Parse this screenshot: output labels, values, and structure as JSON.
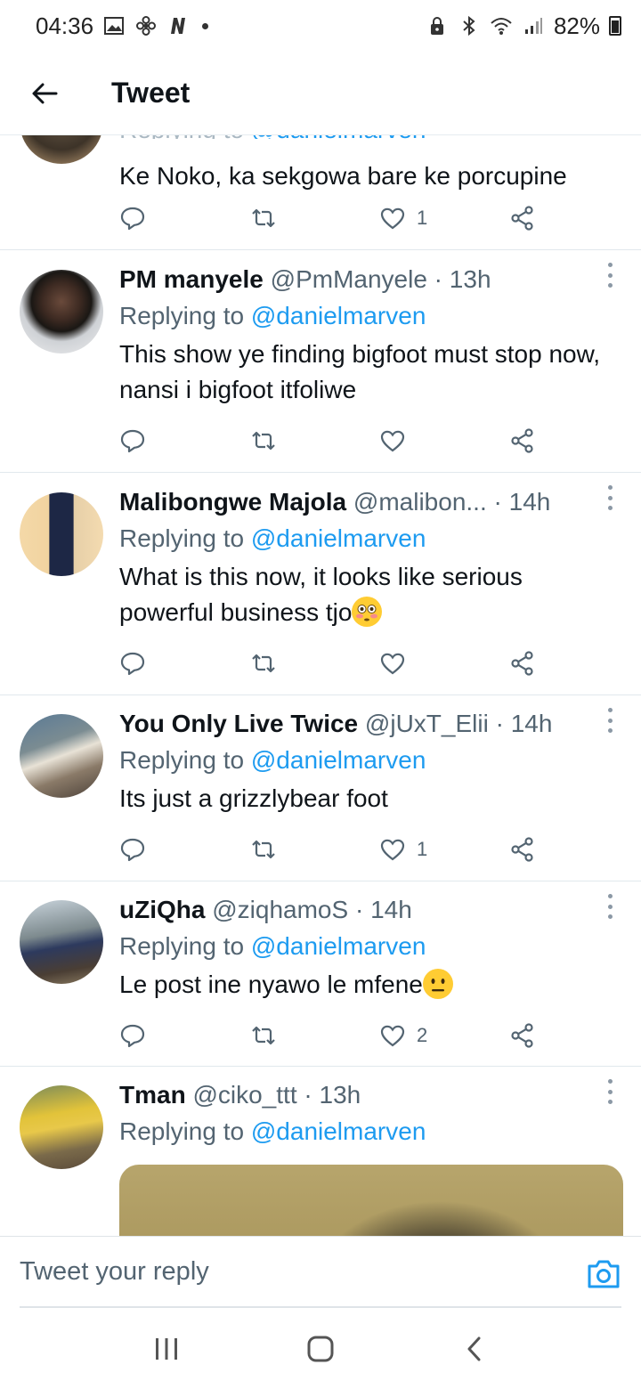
{
  "status_bar": {
    "time": "04:36",
    "battery": "82%",
    "icons": [
      "gallery-icon",
      "fan-icon",
      "netflix-n-icon",
      "notification-dot-icon",
      "lock-icon",
      "bluetooth-icon",
      "wifi-icon",
      "signal-icon",
      "battery-icon"
    ]
  },
  "header": {
    "title": "Tweet",
    "back_icon": "back-arrow-icon"
  },
  "partial_tweet": {
    "reply_prefix": "Replying to ",
    "mention": "@danielmarven",
    "text": "Ke Noko, ka sekgowa bare  ke porcupine",
    "like_count": "1"
  },
  "tweets": [
    {
      "name": "PM manyele",
      "handle": "@PmManyele",
      "time": "13h",
      "reply_prefix": "Replying to ",
      "mention": "@danielmarven",
      "text": "This show ye finding bigfoot must stop now, nansi i  bigfoot itfoliwe",
      "like_count": ""
    },
    {
      "name": "Malibongwe Majola",
      "handle": "@malibon...",
      "time": "14h",
      "reply_prefix": "Replying to ",
      "mention": "@danielmarven",
      "text": "What is this now, it looks like serious powerful business tjo",
      "emoji": "flushed-face-emoji",
      "like_count": ""
    },
    {
      "name": "You Only Live Twice",
      "handle": "@jUxT_Elii",
      "time": "14h",
      "reply_prefix": "Replying to ",
      "mention": "@danielmarven",
      "text": "Its just a grizzlybear foot",
      "like_count": "1"
    },
    {
      "name": "uZiQha",
      "handle": "@ziqhamoS",
      "time": "14h",
      "reply_prefix": "Replying to ",
      "mention": "@danielmarven",
      "text": "Le post ine nyawo le mfene",
      "emoji": "neutral-face-emoji",
      "like_count": "2"
    },
    {
      "name": "Tman",
      "handle": "@ciko_ttt",
      "time": "13h",
      "reply_prefix": "Replying to ",
      "mention": "@danielmarven"
    }
  ],
  "separator": " · ",
  "composer": {
    "placeholder": "Tweet your reply",
    "camera_icon": "camera-icon"
  },
  "navbar": {
    "icons": [
      "recent-apps-icon",
      "home-icon",
      "back-icon"
    ]
  },
  "colors": {
    "link": "#1d9bf0",
    "secondary_text": "#536471",
    "primary_text": "#0f1419"
  }
}
